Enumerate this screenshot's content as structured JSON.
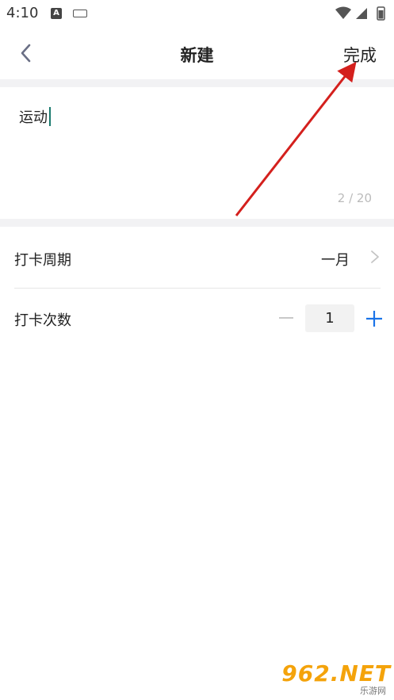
{
  "status_bar": {
    "time": "4:10",
    "icons": [
      "a-icon",
      "keyboard-icon",
      "wifi-icon",
      "signal-icon",
      "battery-icon"
    ]
  },
  "nav": {
    "title": "新建",
    "done_label": "完成"
  },
  "name_input": {
    "value": "运动",
    "char_count": "2 / 20"
  },
  "settings": [
    {
      "label": "打卡周期",
      "value": "一月"
    },
    {
      "label": "打卡次数",
      "value": "1"
    }
  ],
  "watermark": {
    "text": "962.NET",
    "sub": "乐游网"
  },
  "colors": {
    "accent": "#1a73e8",
    "caret": "#1a7a6e",
    "annotation": "#d4201d",
    "watermark": "#f4a30b"
  }
}
